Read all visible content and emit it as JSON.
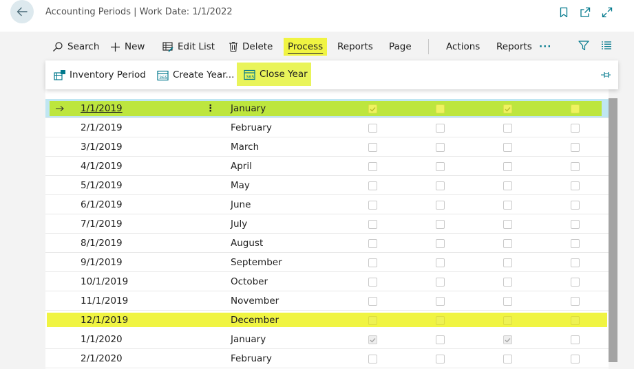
{
  "header": {
    "title": "Accounting Periods | Work Date: 1/1/2022"
  },
  "actions": {
    "search": "Search",
    "new": "New",
    "edit_list": "Edit List",
    "delete": "Delete",
    "process": "Process",
    "reports": "Reports",
    "page": "Page",
    "actions": "Actions",
    "reports2": "Reports",
    "more": "···"
  },
  "flyout": {
    "inventory_period": "Inventory Period",
    "create_year": "Create Year...",
    "close_year": "Close Year"
  },
  "rows": [
    {
      "date": "1/1/2019",
      "name": "January",
      "c1": true,
      "c2": false,
      "c3": true,
      "c4": false
    },
    {
      "date": "2/1/2019",
      "name": "February",
      "c1": false,
      "c2": false,
      "c3": false,
      "c4": false
    },
    {
      "date": "3/1/2019",
      "name": "March",
      "c1": false,
      "c2": false,
      "c3": false,
      "c4": false
    },
    {
      "date": "4/1/2019",
      "name": "April",
      "c1": false,
      "c2": false,
      "c3": false,
      "c4": false
    },
    {
      "date": "5/1/2019",
      "name": "May",
      "c1": false,
      "c2": false,
      "c3": false,
      "c4": false
    },
    {
      "date": "6/1/2019",
      "name": "June",
      "c1": false,
      "c2": false,
      "c3": false,
      "c4": false
    },
    {
      "date": "7/1/2019",
      "name": "July",
      "c1": false,
      "c2": false,
      "c3": false,
      "c4": false
    },
    {
      "date": "8/1/2019",
      "name": "August",
      "c1": false,
      "c2": false,
      "c3": false,
      "c4": false
    },
    {
      "date": "9/1/2019",
      "name": "September",
      "c1": false,
      "c2": false,
      "c3": false,
      "c4": false
    },
    {
      "date": "10/1/2019",
      "name": "October",
      "c1": false,
      "c2": false,
      "c3": false,
      "c4": false
    },
    {
      "date": "11/1/2019",
      "name": "November",
      "c1": false,
      "c2": false,
      "c3": false,
      "c4": false
    },
    {
      "date": "12/1/2019",
      "name": "December",
      "c1": false,
      "c2": false,
      "c3": false,
      "c4": false
    },
    {
      "date": "1/1/2020",
      "name": "January",
      "c1": true,
      "c2": false,
      "c3": true,
      "c4": false
    },
    {
      "date": "2/1/2020",
      "name": "February",
      "c1": false,
      "c2": false,
      "c3": false,
      "c4": false
    }
  ],
  "colors": {
    "accent": "#00788c",
    "selected_row": "#bfe6f2",
    "highlight_green": "#bde63e",
    "highlight_yellow": "#f0f442"
  }
}
